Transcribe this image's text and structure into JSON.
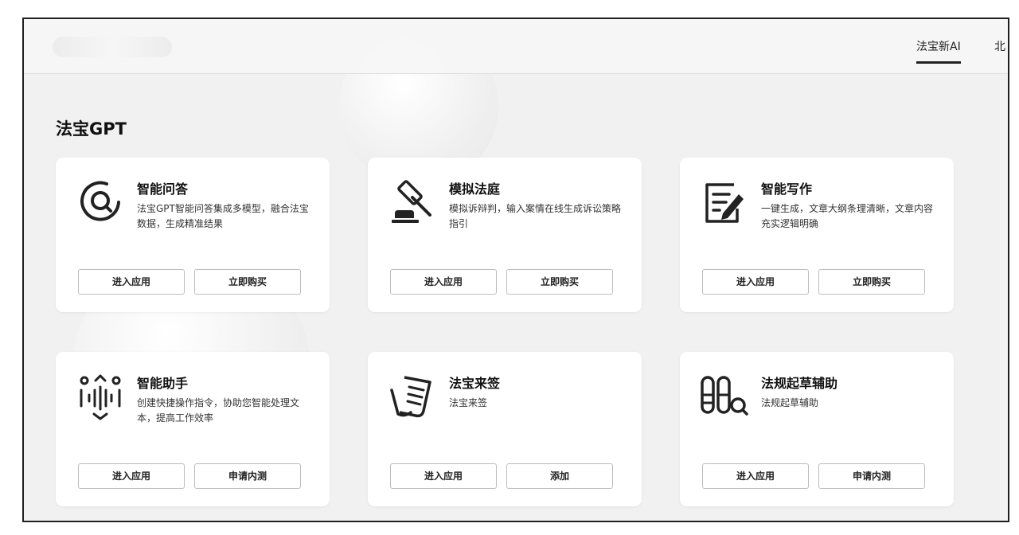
{
  "nav": {
    "items": [
      "法宝新AI",
      "北"
    ]
  },
  "section": {
    "title": "法宝GPT"
  },
  "cards": [
    {
      "icon": "search-icon",
      "title": "智能问答",
      "desc": "法宝GPT智能问答集成多模型，融合法宝数据，生成精准结果",
      "btn_primary": "进入应用",
      "btn_secondary": "立即购买"
    },
    {
      "icon": "gavel-icon",
      "title": "模拟法庭",
      "desc": "模拟诉辩判，输入案情在线生成诉讼策略指引",
      "btn_primary": "进入应用",
      "btn_secondary": "立即购买"
    },
    {
      "icon": "edit-document-icon",
      "title": "智能写作",
      "desc": "一键生成，文章大纲条理清晰，文章内容充实逻辑明确",
      "btn_primary": "进入应用",
      "btn_secondary": "立即购买"
    },
    {
      "icon": "voice-assistant-icon",
      "title": "智能助手",
      "desc": "创建快捷操作指令，协助您智能处理文本，提高工作效率",
      "btn_primary": "进入应用",
      "btn_secondary": "申请内测"
    },
    {
      "icon": "scroll-list-icon",
      "title": "法宝来签",
      "desc": "法宝来签",
      "btn_primary": "进入应用",
      "btn_secondary": "添加"
    },
    {
      "icon": "draft-search-icon",
      "title": "法规起草辅助",
      "desc": "法规起草辅助",
      "btn_primary": "进入应用",
      "btn_secondary": "申请内测"
    }
  ]
}
